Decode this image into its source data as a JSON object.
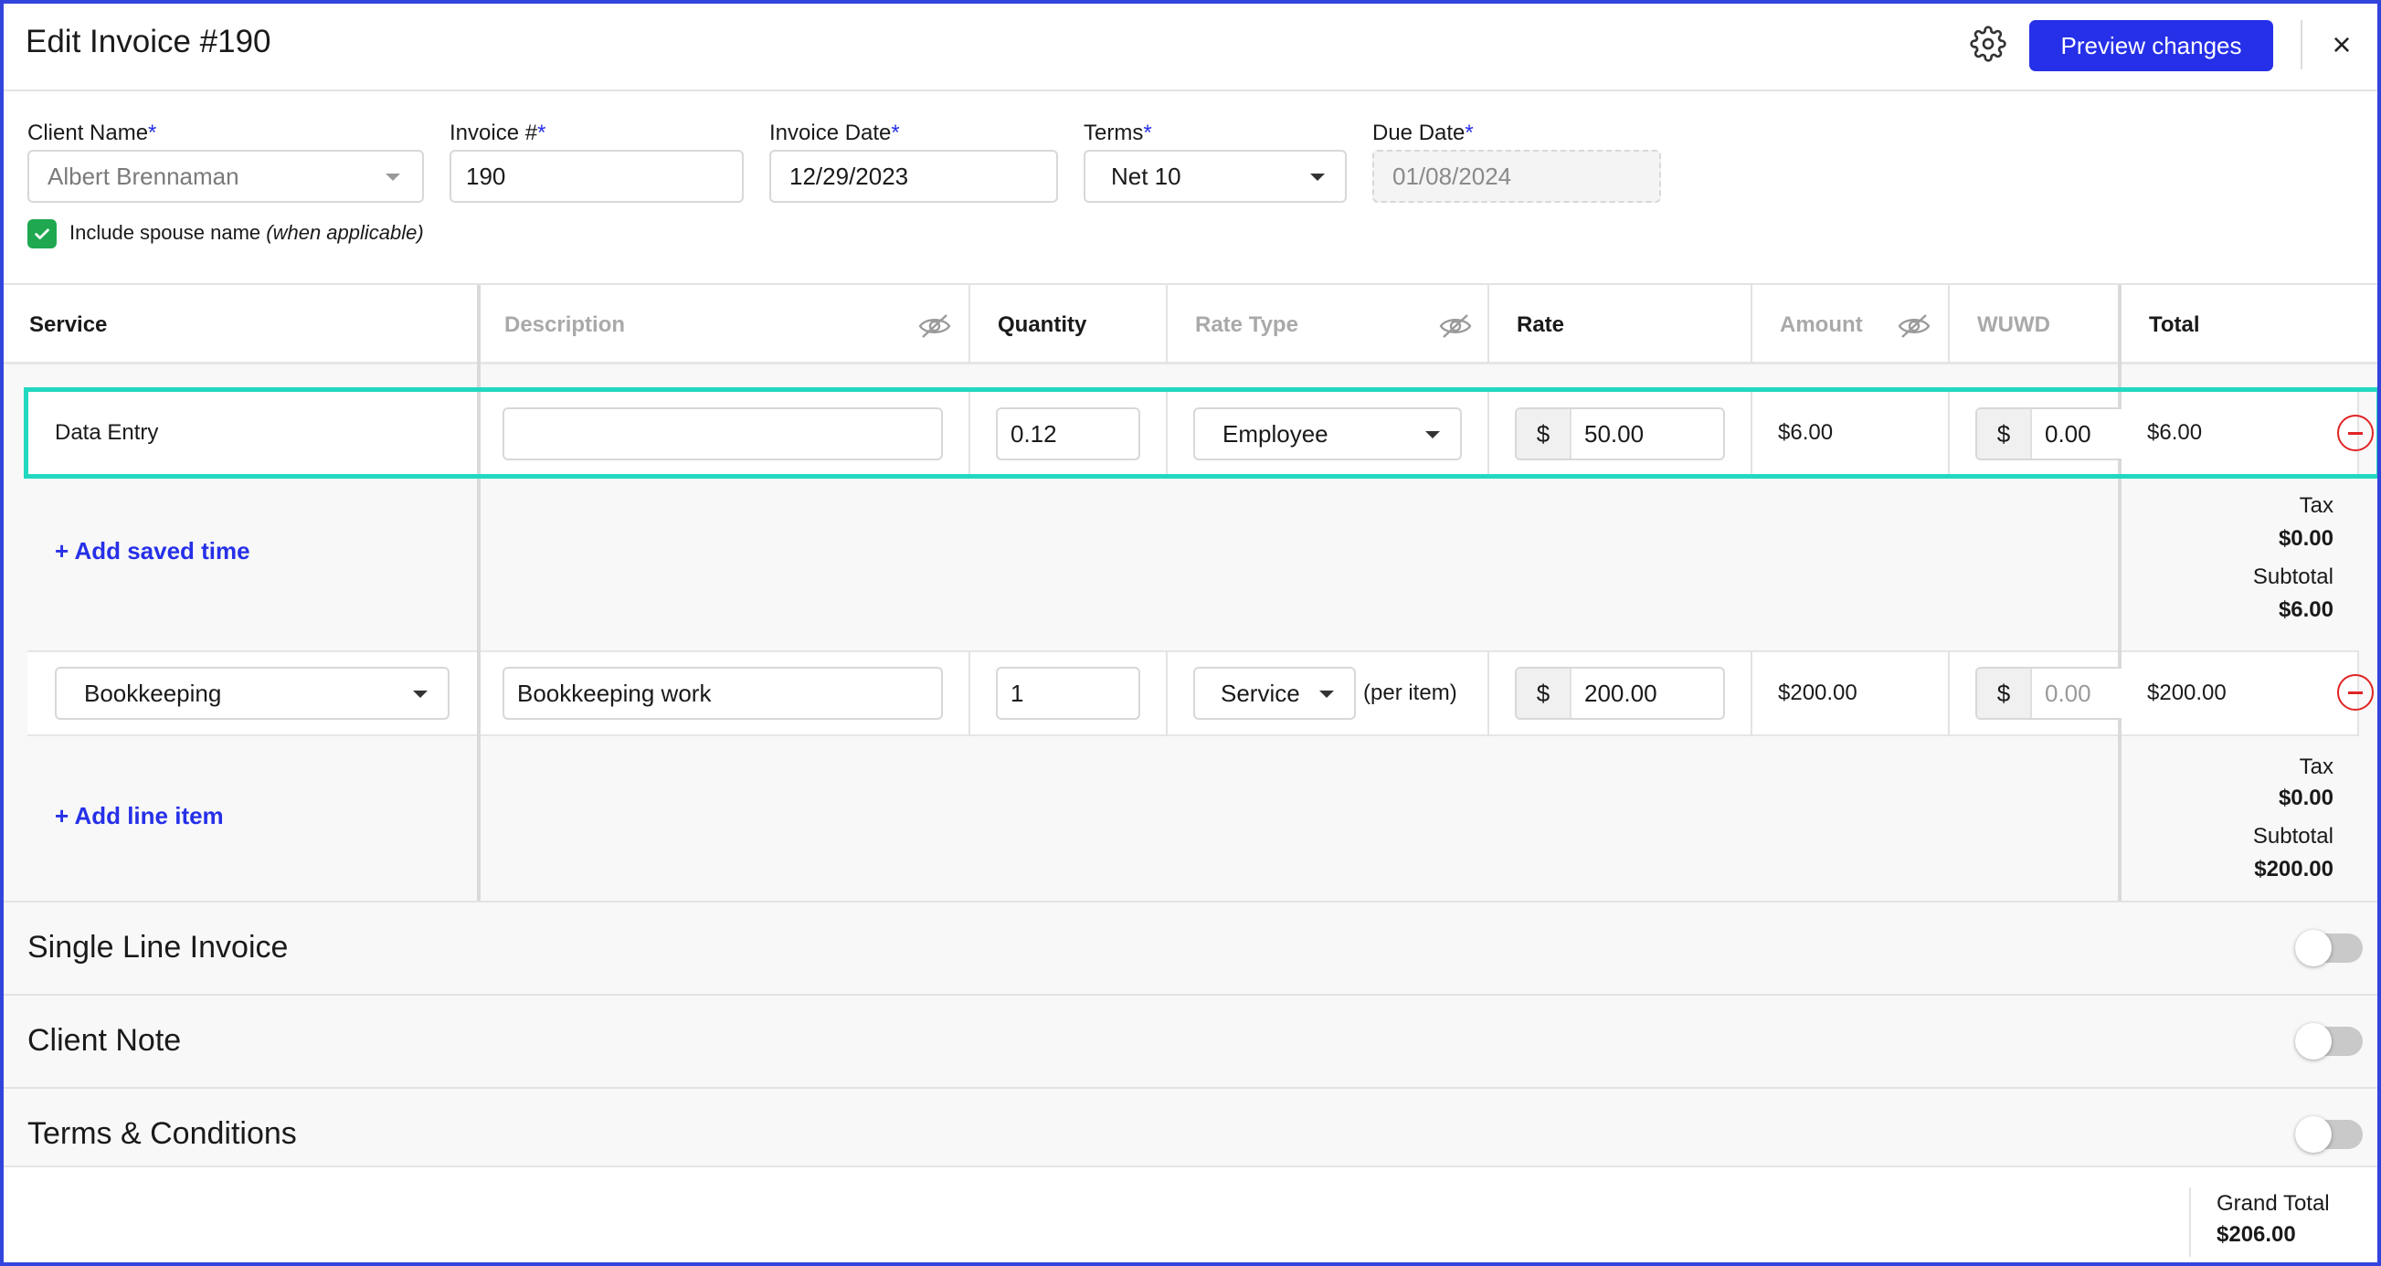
{
  "header": {
    "title": "Edit Invoice #190",
    "preview_label": "Preview changes",
    "close_glyph": "×"
  },
  "form": {
    "client_name": {
      "label": "Client Name",
      "value": "Albert Brennaman"
    },
    "invoice_number": {
      "label": "Invoice #",
      "value": "190"
    },
    "invoice_date": {
      "label": "Invoice Date",
      "value": "12/29/2023"
    },
    "terms": {
      "label": "Terms",
      "value": "Net 10"
    },
    "due_date": {
      "label": "Due Date",
      "value": "01/08/2024"
    },
    "required_mark": "*",
    "spouse_checkbox": {
      "label": "Include spouse name",
      "hint": "(when applicable)",
      "checked": true
    }
  },
  "table": {
    "headers": {
      "service": "Service",
      "description": "Description",
      "quantity": "Quantity",
      "rate_type": "Rate Type",
      "rate": "Rate",
      "amount": "Amount",
      "wuwd": "WUWD",
      "total": "Total"
    },
    "currency_symbol": "$",
    "rows": [
      {
        "service": "Data Entry",
        "description": "",
        "quantity": "0.12",
        "rate_type": "Employee",
        "rate": "50.00",
        "amount": "$6.00",
        "wuwd": "0.00",
        "total": "$6.00"
      },
      {
        "service": "Bookkeeping",
        "description": "Bookkeeping work",
        "quantity": "1",
        "rate_type": "Service",
        "rate_suffix": "(per item)",
        "rate": "200.00",
        "amount": "$200.00",
        "wuwd": "0.00",
        "total": "$200.00"
      }
    ],
    "group1": {
      "add_label": "+ Add saved time",
      "tax_label": "Tax",
      "tax_value": "$0.00",
      "subtotal_label": "Subtotal",
      "subtotal_value": "$6.00"
    },
    "group2": {
      "add_label": "+ Add line item",
      "tax_label": "Tax",
      "tax_value": "$0.00",
      "subtotal_label": "Subtotal",
      "subtotal_value": "$200.00"
    }
  },
  "sections": [
    {
      "title": "Single Line Invoice",
      "enabled": false
    },
    {
      "title": "Client Note",
      "enabled": false
    },
    {
      "title": "Terms & Conditions",
      "enabled": false
    }
  ],
  "footer": {
    "grand_total_label": "Grand Total",
    "grand_total_value": "$206.00"
  },
  "colors": {
    "accent": "#2630e8",
    "highlight": "#22d8c0",
    "danger": "#e02424",
    "success": "#1fa850"
  },
  "icons": {
    "settings": "gear-icon",
    "close": "close-icon",
    "hidden": "eye-slash-icon",
    "remove": "minus-circle-icon",
    "check": "check-icon",
    "dropdown": "caret-down-icon"
  }
}
